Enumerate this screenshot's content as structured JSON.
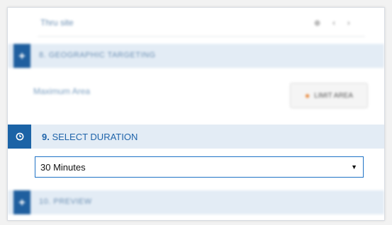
{
  "top_row": {
    "label": "Thru site",
    "controls": [
      "⊕",
      "‹",
      "›"
    ]
  },
  "geo_section": {
    "number": "8.",
    "title": "GEOGRAPHIC TARGETING"
  },
  "area_row": {
    "label": "Maximum Area",
    "button_label": "LIMIT AREA"
  },
  "duration_section": {
    "number": "9.",
    "title": "SELECT DURATION"
  },
  "duration_select": {
    "value": "30 Minutes",
    "arrow": "▼"
  },
  "preview_section": {
    "number": "10.",
    "title": "PREVIEW"
  },
  "colors": {
    "accent": "#1b63a6",
    "section_bg": "#e3ecf5",
    "select_border": "#1f73c6"
  }
}
